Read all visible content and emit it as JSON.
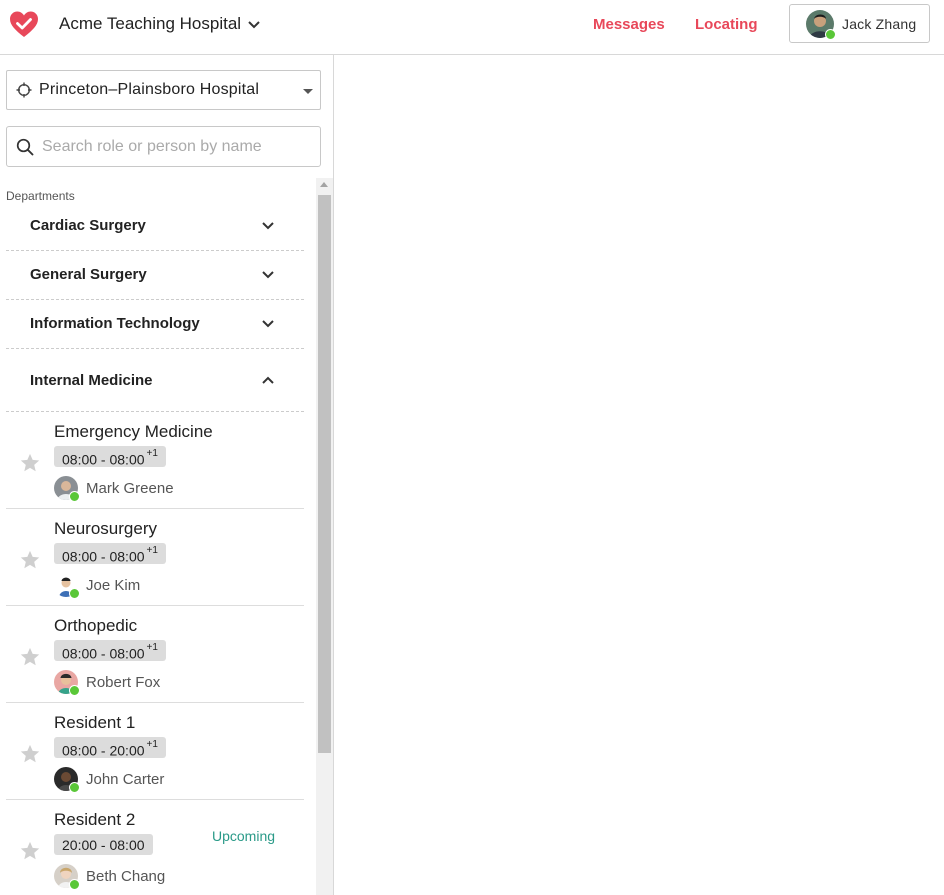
{
  "header": {
    "org_name": "Acme Teaching Hospital",
    "nav": [
      "Messages",
      "Locating"
    ],
    "user_name": "Jack Zhang",
    "accent_color": "#e8485a"
  },
  "sidebar": {
    "hospital": "Princeton–Plainsboro Hospital",
    "search_placeholder": "Search role or person by name",
    "section_label": "Departments",
    "departments": [
      {
        "name": "Cardiac Surgery",
        "expanded": false
      },
      {
        "name": "General Surgery",
        "expanded": false
      },
      {
        "name": "Information Technology",
        "expanded": false
      },
      {
        "name": "Internal Medicine",
        "expanded": true
      }
    ],
    "roles": [
      {
        "name": "Emergency Medicine",
        "shift": "08:00 - 08:00",
        "day_offset": "+1",
        "person": "Mark Greene",
        "status": ""
      },
      {
        "name": "Neurosurgery",
        "shift": "08:00 - 08:00",
        "day_offset": "+1",
        "person": "Joe Kim",
        "status": ""
      },
      {
        "name": "Orthopedic",
        "shift": "08:00 - 08:00",
        "day_offset": "+1",
        "person": "Robert Fox",
        "status": ""
      },
      {
        "name": "Resident 1",
        "shift": "08:00 - 20:00",
        "day_offset": "+1",
        "person": "John Carter",
        "status": ""
      },
      {
        "name": "Resident 2",
        "shift": "20:00 - 08:00",
        "day_offset": "",
        "person": "Beth Chang",
        "status": "Upcoming"
      }
    ]
  }
}
